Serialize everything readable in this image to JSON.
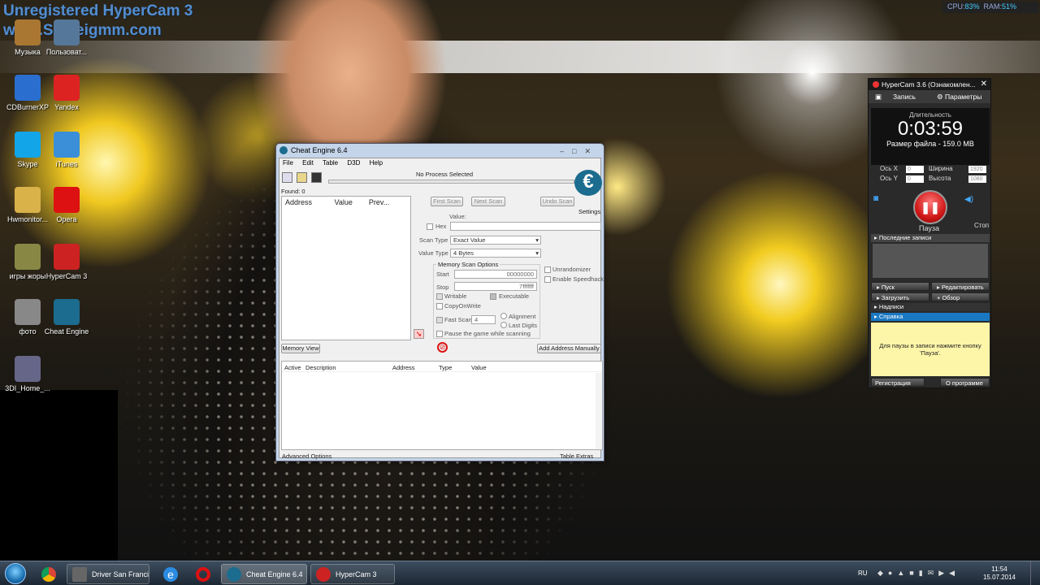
{
  "watermark": {
    "line1": "Unregistered HyperCam 3",
    "line2": "www.Solveigmm.com"
  },
  "sysmon": {
    "cpu_label": "CPU:",
    "cpu": "83%",
    "ram_label": "RAM:",
    "ram": "51%"
  },
  "desktop_icons": [
    {
      "label": "Музыка",
      "color": "#aa7733"
    },
    {
      "label": "Пользоват...",
      "color": "#557799"
    },
    {
      "label": "CDBurnerXP",
      "color": "#2a6fd0"
    },
    {
      "label": "Yandex",
      "color": "#d22"
    },
    {
      "label": "Skype",
      "color": "#12a5e8"
    },
    {
      "label": "iTunes",
      "color": "#3a8fd8"
    },
    {
      "label": "Hwmonitor...",
      "color": "#d9b24a"
    },
    {
      "label": "Opera",
      "color": "#d11"
    },
    {
      "label": "игры жоры",
      "color": "#884"
    },
    {
      "label": "HyperCam 3",
      "color": "#c22"
    },
    {
      "label": "фото",
      "color": "#888"
    },
    {
      "label": "Cheat Engine",
      "color": "#1b6c8e"
    },
    {
      "label": "3DI_Home_...",
      "color": "#668"
    }
  ],
  "ce": {
    "title": "Cheat Engine 6.4",
    "menu": [
      "File",
      "Edit",
      "Table",
      "D3D",
      "Help"
    ],
    "process": "No Process Selected",
    "found": "Found: 0",
    "list_headers": {
      "address": "Address",
      "value": "Value",
      "prev": "Prev..."
    },
    "first_scan": "First Scan",
    "next_scan": "Next Scan",
    "undo_scan": "Undo Scan",
    "settings": "Settings",
    "value_label": "Value:",
    "hex": "Hex",
    "scan_type_label": "Scan Type",
    "scan_type": "Exact Value",
    "value_type_label": "Value Type",
    "value_type": "4 Bytes",
    "mem_opts": "Memory Scan Options",
    "start_label": "Start",
    "start": "00000000",
    "stop_label": "Stop",
    "stop": "7fffffff",
    "writable": "Writable",
    "executable": "Executable",
    "copyonwrite": "CopyOnWrite",
    "fast_scan": "Fast Scan",
    "fast_val": "4",
    "alignment": "Alignment",
    "last_digits": "Last Digits",
    "pause": "Pause the game while scanning",
    "unrandomizer": "Unrandomizer",
    "speedhack": "Enable Speedhack",
    "memory_view": "Memory View",
    "add_manual": "Add Address Manually",
    "table_headers": {
      "active": "Active",
      "desc": "Description",
      "address": "Address",
      "type": "Type",
      "value": "Value"
    },
    "advanced": "Advanced Options",
    "extras": "Table Extras"
  },
  "hc": {
    "title": "HyperCam 3.6 (Ознакомлен...",
    "tab_rec": "Запись",
    "tab_params": "Параметры",
    "duration_label": "Длительность",
    "time": "0:03:59",
    "filesize": "Размер файла - 159.0 MB",
    "axis_x": "Ось X",
    "axis_y": "Ось Y",
    "width_label": "Ширина",
    "height_label": "Высота",
    "width": "1920",
    "height": "1080",
    "x": "0",
    "y": "0",
    "pause": "Пауза",
    "stop": "Стоп",
    "recent": "Последние записи",
    "start_btn": "Пуск",
    "edit_btn": "Редактировать",
    "load_btn": "Загрузить",
    "browse_btn": "Обзор",
    "captions": "Надписи",
    "help": "Справка",
    "hint": "Для паузы в записи нажмите кнопку 'Пауза'.",
    "register": "Регистрация",
    "about": "О программе"
  },
  "taskbar": {
    "items": [
      {
        "label": "Driver San Francis...",
        "color": "#666"
      },
      {
        "label": "Cheat Engine 6.4",
        "color": "#1b6c8e"
      },
      {
        "label": "HyperCam 3",
        "color": "#c22"
      }
    ],
    "lang": "RU",
    "time": "11:54",
    "date": "15.07.2014"
  }
}
